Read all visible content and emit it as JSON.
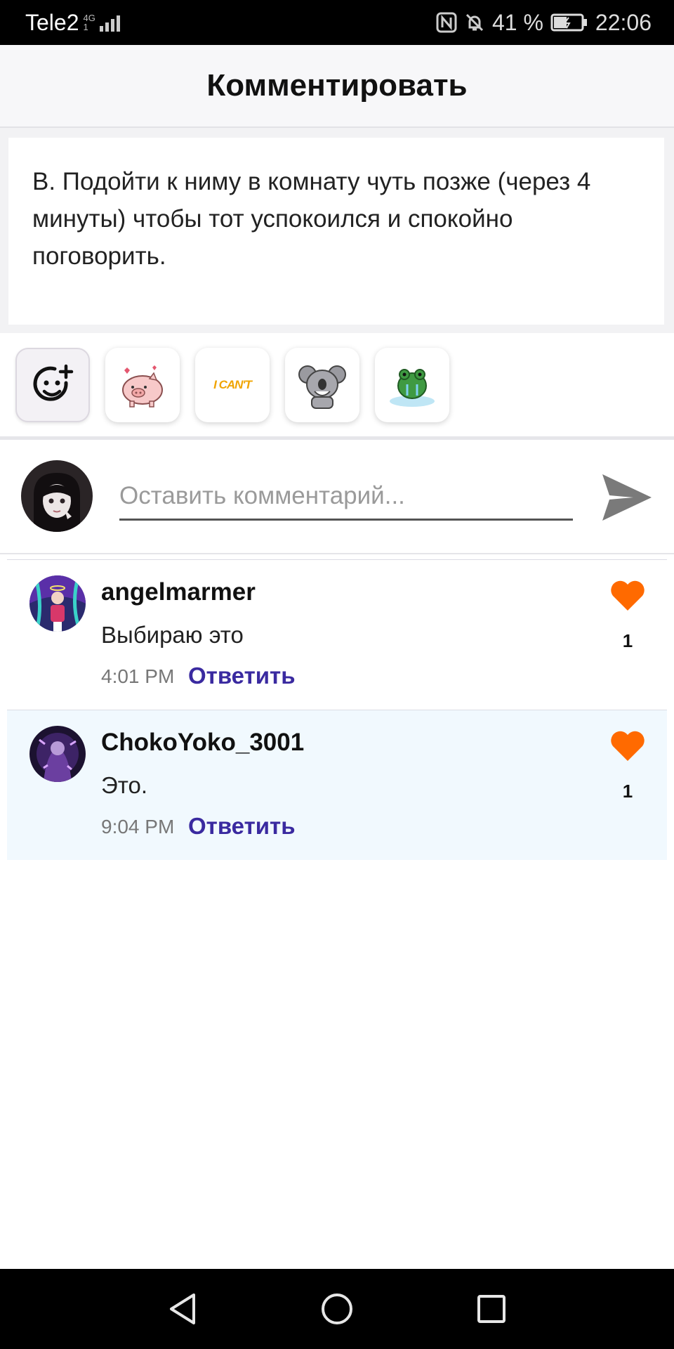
{
  "status_bar": {
    "carrier": "Tele2",
    "network_top": "4G",
    "network_bottom": "1",
    "battery_percent": "41 %",
    "time": "22:06"
  },
  "header": {
    "title": "Комментировать"
  },
  "post": {
    "text": "В. Подойти к ниму в комнату чуть позже (через 4 минуты) чтобы тот успокоился и спокойно поговорить."
  },
  "stickers": {
    "items": [
      {
        "name": "emoji-picker-icon"
      },
      {
        "name": "pig-sticker-icon"
      },
      {
        "name": "i-cant-sticker",
        "text": "I CAN'T"
      },
      {
        "name": "koala-sticker-icon"
      },
      {
        "name": "frog-sticker-icon"
      }
    ]
  },
  "input": {
    "placeholder": "Оставить комментарий..."
  },
  "comments": [
    {
      "user": "angelmarmer",
      "text": "Выбираю это",
      "time": "4:01 PM",
      "reply": "Ответить",
      "likes": "1"
    },
    {
      "user": "ChokoYoko_3001",
      "text": "Это.",
      "time": "9:04 PM",
      "reply": "Ответить",
      "likes": "1"
    }
  ],
  "colors": {
    "like": "#ff6a00",
    "reply": "#3a2aa0",
    "highlight_row": "#f1f9fe"
  }
}
